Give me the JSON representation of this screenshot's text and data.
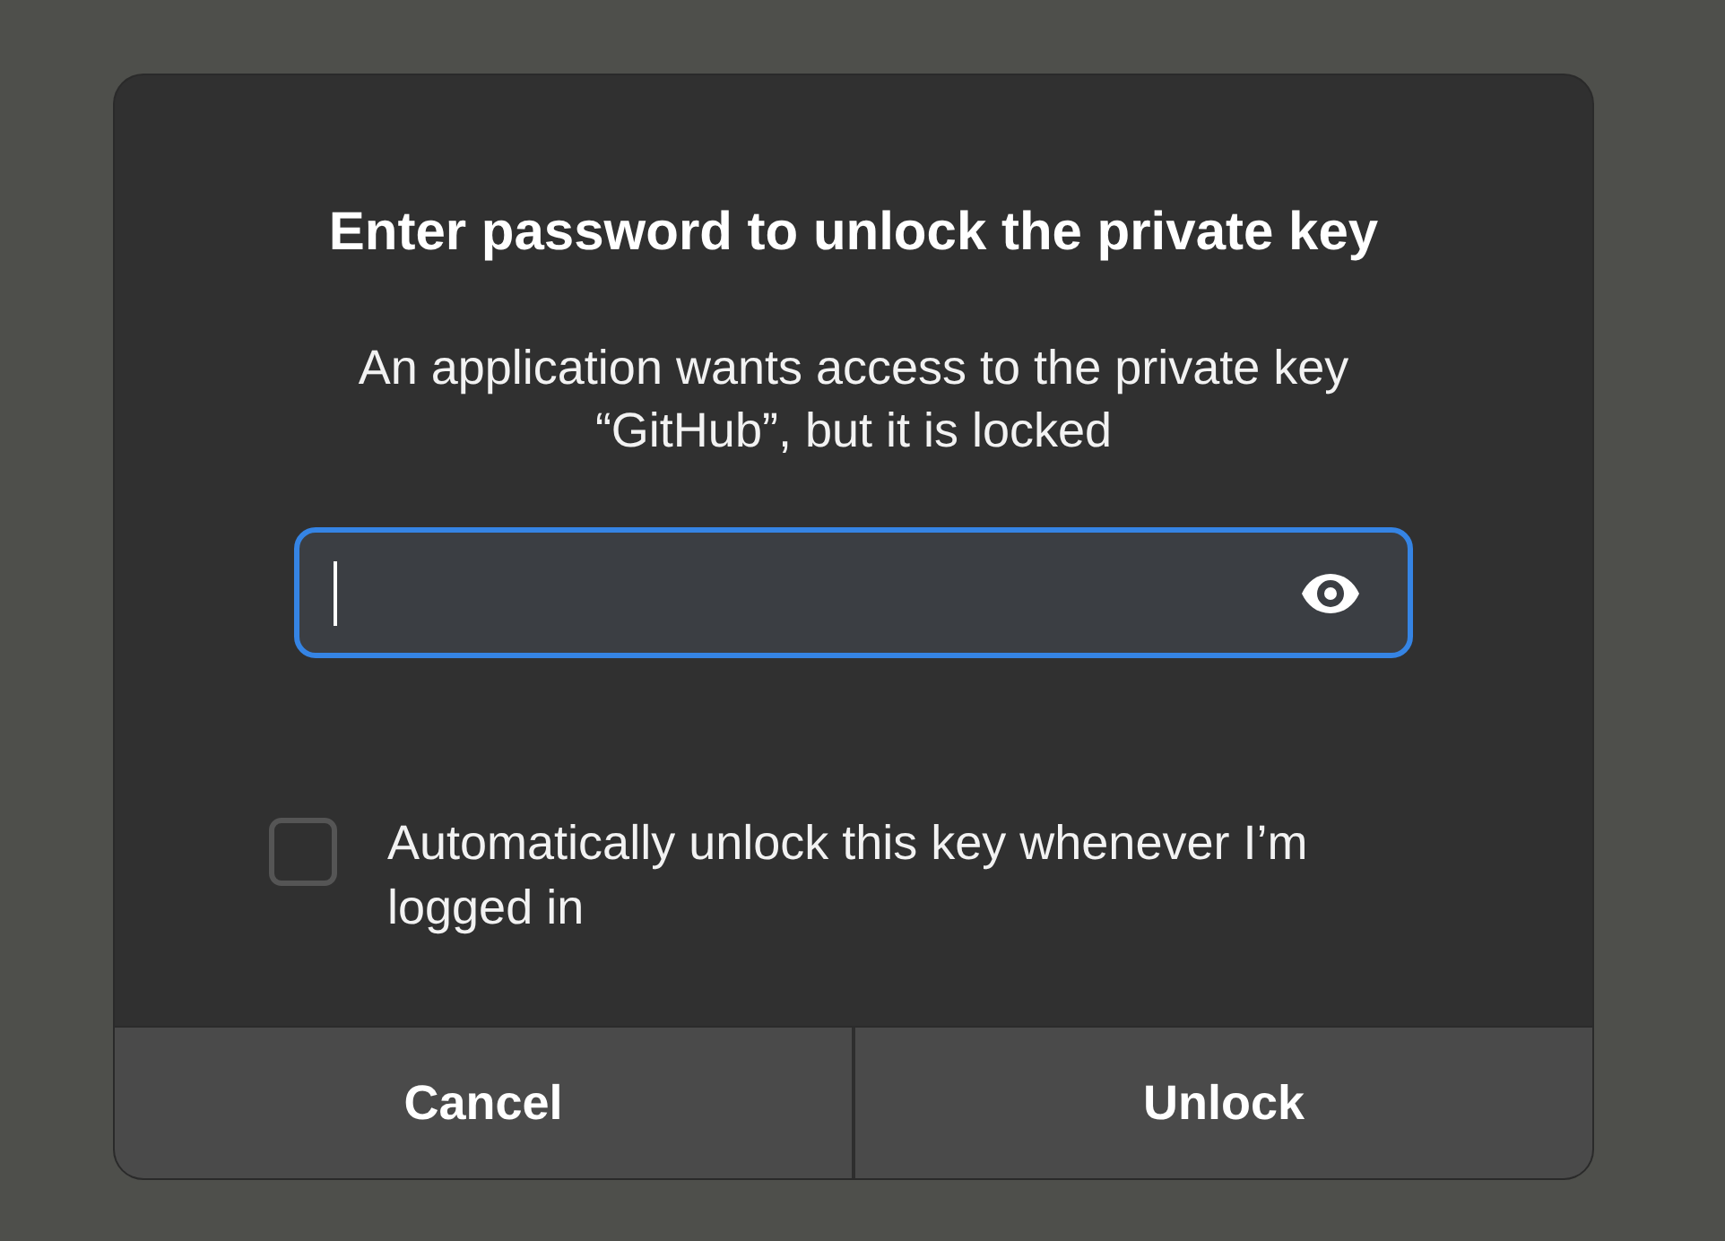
{
  "dialog": {
    "title": "Enter password to unlock the private key",
    "message": "An application wants access to the private key “GitHub”, but it is locked",
    "password_field": {
      "focused": true
    },
    "auto_unlock": {
      "label": "Automatically unlock this key whenever I’m logged in",
      "checked": false
    },
    "buttons": [
      "Cancel",
      "Unlock"
    ]
  }
}
